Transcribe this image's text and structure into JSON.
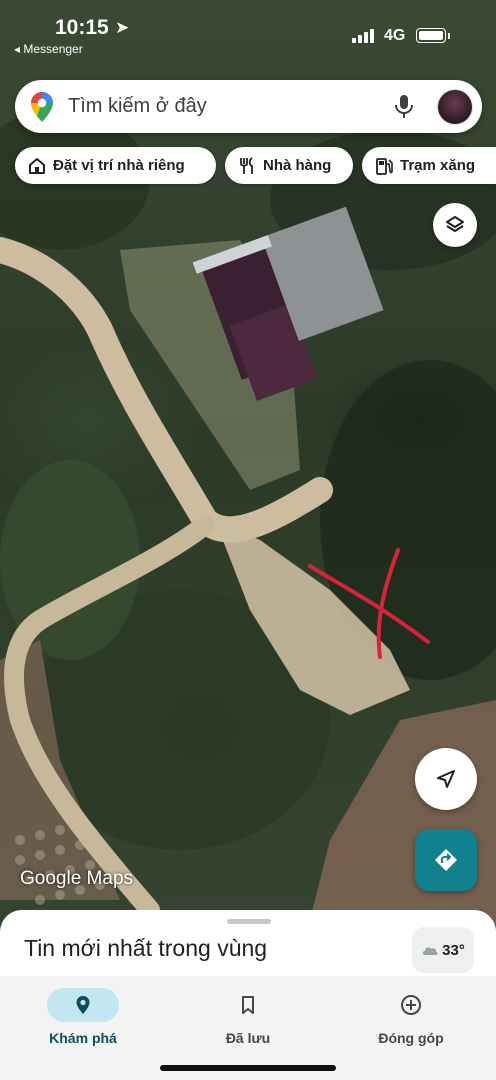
{
  "status_bar": {
    "time": "10:15",
    "back_app": "◂ Messenger",
    "network": "4G"
  },
  "search": {
    "placeholder": "Tìm kiếm ở đây"
  },
  "chips": [
    {
      "label": "Đặt vị trí nhà riêng",
      "icon": "home-icon"
    },
    {
      "label": "Nhà hàng",
      "icon": "restaurant-icon"
    },
    {
      "label": "Trạm xăng",
      "icon": "gas-station-icon"
    }
  ],
  "map": {
    "watermark": "Google Maps",
    "annotation": "red-hand-drawn-x"
  },
  "sheet": {
    "title": "Tin mới nhất trong vùng",
    "temperature": "33°"
  },
  "nav": {
    "items": [
      {
        "label": "Khám phá",
        "icon": "location-pin-icon",
        "active": true
      },
      {
        "label": "Đã lưu",
        "icon": "bookmark-icon",
        "active": false
      },
      {
        "label": "Đóng góp",
        "icon": "add-circle-icon",
        "active": false
      }
    ]
  },
  "colors": {
    "accent_teal": "#11808f",
    "nav_active_pill": "#c2e7f0",
    "annotation_red": "#d8243a"
  }
}
